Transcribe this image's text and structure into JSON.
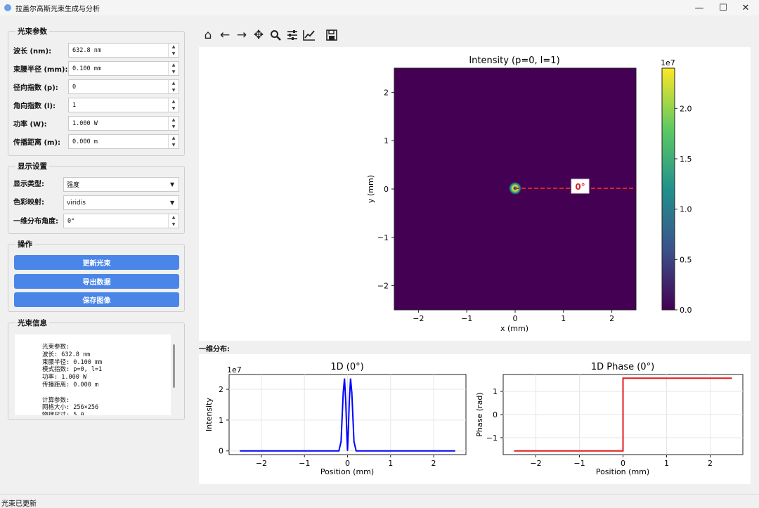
{
  "window": {
    "title": "拉盖尔高斯光束生成与分析",
    "minimize": "—",
    "maximize": "☐",
    "close": "✕"
  },
  "params_group": {
    "title": "光束参数",
    "rows": [
      {
        "label": "波长 (nm):",
        "value": "632.8 nm"
      },
      {
        "label": "束腰半径 (mm):",
        "value": "0.100 mm"
      },
      {
        "label": "径向指数 (p):",
        "value": "0"
      },
      {
        "label": "角向指数 (l):",
        "value": "1"
      },
      {
        "label": "功率 (W):",
        "value": "1.000 W"
      },
      {
        "label": "传播距离 (m):",
        "value": "0.000 m"
      }
    ]
  },
  "display_group": {
    "title": "显示设置",
    "display_type_label": "显示类型:",
    "display_type_value": "强度",
    "colormap_label": "色彩映射:",
    "colormap_value": "viridis",
    "angle_label": "一维分布角度:",
    "angle_value": "0°"
  },
  "ops_group": {
    "title": "操作",
    "update_label": "更新光束",
    "export_label": "导出数据",
    "save_label": "保存图像"
  },
  "info_group": {
    "title": "光束信息",
    "text": "光束参数:\n波长: 632.8 nm\n束腰半径: 0.100 mm\n模式指数: p=0, l=1\n功率: 1.000 W\n传播距离: 0.000 m\n\n计算参数:\n网格大小: 256×256\n物理尺寸: 5.0"
  },
  "toolbar": {
    "icons": [
      "home-icon",
      "back-arrow-icon",
      "forward-arrow-icon",
      "pan-icon",
      "zoom-icon",
      "configure-subplots-icon",
      "edit-axis-icon",
      "save-figure-icon"
    ]
  },
  "main_plot": {
    "title": "Intensity (p=0, l=1)",
    "xlabel": "x (mm)",
    "ylabel": "y (mm)",
    "x_ticks": [
      "−2",
      "−1",
      "0",
      "1",
      "2"
    ],
    "y_ticks": [
      "2",
      "1",
      "0",
      "−1",
      "−2"
    ],
    "angle_marker": "0°",
    "colorbar_exponent": "1e7",
    "colorbar_ticks": [
      "2.0",
      "1.5",
      "1.0",
      "0.5",
      "0.0"
    ]
  },
  "section_label": "一维分布:",
  "intensity_1d": {
    "title": "1D (0°)",
    "xlabel": "Position (mm)",
    "ylabel": "Intensity",
    "exponent": "1e7",
    "x_ticks": [
      "−2",
      "−1",
      "0",
      "1",
      "2"
    ],
    "y_ticks": [
      "2",
      "1",
      "0"
    ]
  },
  "phase_1d": {
    "title": "1D Phase (0°)",
    "xlabel": "Position (mm)",
    "ylabel": "Phase (rad)",
    "x_ticks": [
      "−2",
      "−1",
      "0",
      "1",
      "2"
    ],
    "y_ticks": [
      "1",
      "0",
      "−1"
    ]
  },
  "chart_data": [
    {
      "type": "heatmap",
      "title": "Intensity (p=0, l=1)",
      "xlabel": "x (mm)",
      "ylabel": "y (mm)",
      "xlim": [
        -2.5,
        2.5
      ],
      "ylim": [
        -2.5,
        2.5
      ],
      "colormap": "viridis",
      "colorbar_range": [
        0,
        24000000
      ],
      "peak_value": 23500000,
      "ring_radius_mm": 0.07,
      "line_angle_deg": 0,
      "line_color": "#d62728"
    },
    {
      "type": "line",
      "title": "1D (0°)",
      "xlabel": "Position (mm)",
      "ylabel": "Intensity",
      "xlim": [
        -2.75,
        2.75
      ],
      "ylim": [
        -1200000,
        24800000
      ],
      "series": [
        {
          "color": "#0000ff",
          "x": [
            -2.5,
            -0.2,
            -0.15,
            -0.1,
            -0.07,
            -0.04,
            -0.02,
            0,
            0.02,
            0.04,
            0.07,
            0.1,
            0.15,
            0.2,
            2.5
          ],
          "y": [
            0,
            0,
            3000000,
            19000000,
            23500000,
            16000000,
            7000000,
            0,
            7000000,
            16000000,
            23500000,
            19000000,
            3000000,
            0,
            0
          ]
        }
      ],
      "grid": true
    },
    {
      "type": "line",
      "title": "1D Phase (0°)",
      "xlabel": "Position (mm)",
      "ylabel": "Phase (rad)",
      "xlim": [
        -2.75,
        2.75
      ],
      "ylim": [
        -1.73,
        1.73
      ],
      "series": [
        {
          "color": "#e41a1c",
          "x": [
            -2.5,
            0,
            0,
            2.5
          ],
          "y": [
            -1.57,
            -1.57,
            1.57,
            1.57
          ]
        }
      ],
      "grid": true
    }
  ],
  "status": "光束已更新"
}
